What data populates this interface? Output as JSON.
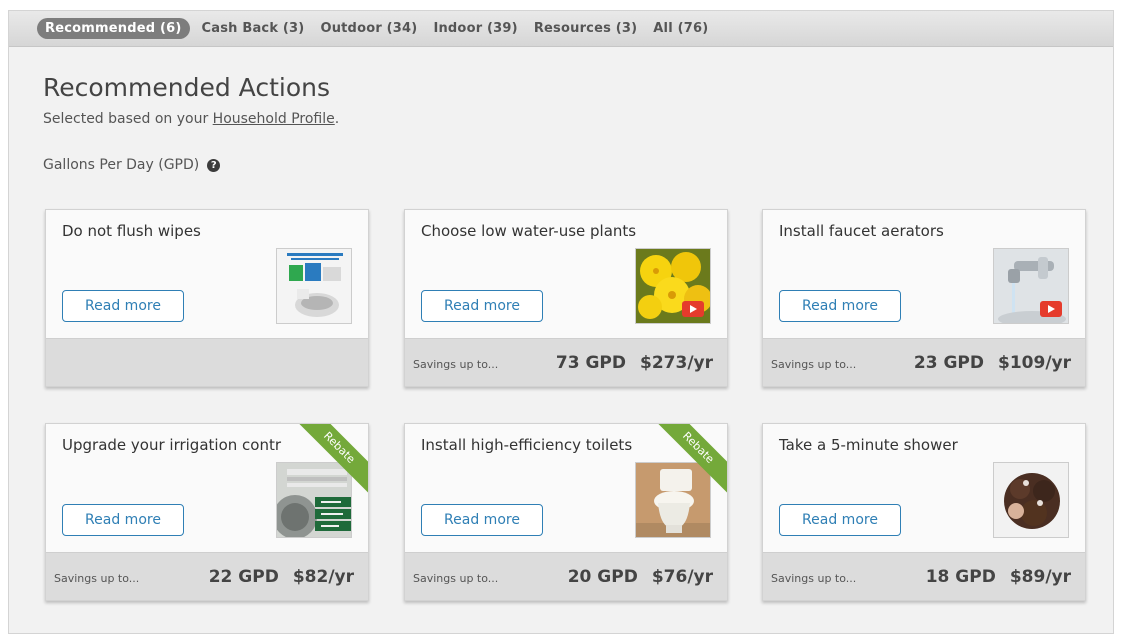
{
  "tabs": [
    {
      "label": "Recommended (6)",
      "active": true
    },
    {
      "label": "Cash Back (3)",
      "active": false
    },
    {
      "label": "Outdoor (34)",
      "active": false
    },
    {
      "label": "Indoor (39)",
      "active": false
    },
    {
      "label": "Resources (3)",
      "active": false
    },
    {
      "label": "All (76)",
      "active": false
    }
  ],
  "page": {
    "title": "Recommended Actions",
    "subtitle_prefix": "Selected based on your ",
    "subtitle_link": "Household Profile",
    "subtitle_suffix": ".",
    "gpd_label": "Gallons Per Day (GPD)",
    "help_glyph": "?"
  },
  "cards": [
    {
      "title": "Do not flush wipes",
      "button": "Read more",
      "icon": "wipes-poster-thumbnail",
      "savings_label": "",
      "gpd": "",
      "yr": "",
      "rebate": ""
    },
    {
      "title": "Choose low water-use plants",
      "button": "Read more",
      "icon": "yellow-flowers-video-thumbnail",
      "savings_label": "Savings up to...",
      "gpd": "73 GPD",
      "yr": "$273/yr",
      "rebate": ""
    },
    {
      "title": "Install faucet aerators",
      "button": "Read more",
      "icon": "faucet-video-thumbnail",
      "savings_label": "Savings up to...",
      "gpd": "23 GPD",
      "yr": "$109/yr",
      "rebate": ""
    },
    {
      "title": "Upgrade your irrigation contr",
      "button": "Read more",
      "icon": "irrigation-controller-thumbnail",
      "savings_label": "Savings up to...",
      "gpd": "22 GPD",
      "yr": "$82/yr",
      "rebate": "Rebate"
    },
    {
      "title": "Install high-efficiency toilets",
      "button": "Read more",
      "icon": "toilet-thumbnail",
      "savings_label": "Savings up to...",
      "gpd": "20 GPD",
      "yr": "$76/yr",
      "rebate": "Rebate"
    },
    {
      "title": "Take a 5-minute shower",
      "button": "Read more",
      "icon": "shower-hair-thumbnail",
      "savings_label": "Savings up to...",
      "gpd": "18 GPD",
      "yr": "$89/yr",
      "rebate": ""
    }
  ],
  "colors": {
    "accent": "#2f7fb5",
    "rebate_green": "#74a93a",
    "active_tab": "#7d7d7d",
    "play_red": "#e53b2c"
  }
}
